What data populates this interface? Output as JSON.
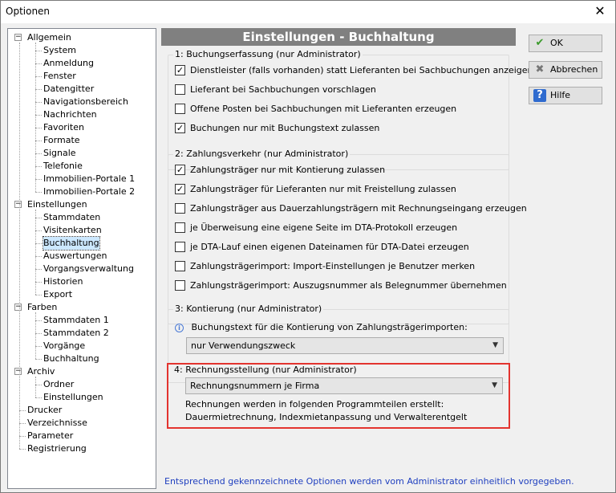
{
  "window": {
    "title": "Optionen",
    "close": "✕"
  },
  "tree": {
    "root": [
      {
        "label": "Allgemein",
        "children": [
          "System",
          "Anmeldung",
          "Fenster",
          "Datengitter",
          "Navigationsbereich",
          "Nachrichten",
          "Favoriten",
          "Formate",
          "Signale",
          "Telefonie",
          "Immobilien-Portale 1",
          "Immobilien-Portale 2"
        ]
      },
      {
        "label": "Einstellungen",
        "children": [
          "Stammdaten",
          "Visitenkarten",
          "Buchhaltung",
          "Auswertungen",
          "Vorgangsverwaltung",
          "Historien",
          "Export"
        ]
      },
      {
        "label": "Farben",
        "children": [
          "Stammdaten 1",
          "Stammdaten 2",
          "Vorgänge",
          "Buchhaltung"
        ]
      },
      {
        "label": "Archiv",
        "children": [
          "Ordner",
          "Einstellungen"
        ]
      }
    ],
    "leaves": [
      "Drucker",
      "Verzeichnisse",
      "Parameter",
      "Registrierung"
    ],
    "selected": "Buchhaltung"
  },
  "panel": {
    "title": "Einstellungen - Buchhaltung",
    "groups": {
      "g1": {
        "label": "1: Buchungserfassung  (nur Administrator)",
        "options": [
          {
            "label": "Dienstleister (falls vorhanden) statt Lieferanten bei Sachbuchungen anzeigen",
            "checked": "✓"
          },
          {
            "label": "Lieferant bei Sachbuchungen vorschlagen",
            "checked": ""
          },
          {
            "label": "Offene Posten bei Sachbuchungen mit Lieferanten erzeugen",
            "checked": ""
          },
          {
            "label": "Buchungen nur mit Buchungstext zulassen",
            "checked": "✓"
          }
        ]
      },
      "g2": {
        "label": "2: Zahlungsverkehr  (nur Administrator)",
        "options": [
          {
            "label": "Zahlungsträger nur mit Kontierung zulassen",
            "checked": "✓"
          },
          {
            "label": "Zahlungsträger für Lieferanten nur mit Freistellung zulassen",
            "checked": "✓"
          },
          {
            "label": "Zahlungsträger aus Dauerzahlungsträgern mit Rechnungseingang erzeugen",
            "checked": ""
          },
          {
            "label": "je Überweisung eine eigene Seite im DTA-Protokoll erzeugen",
            "checked": ""
          },
          {
            "label": "je DTA-Lauf einen eigenen Dateinamen für DTA-Datei erzeugen",
            "checked": ""
          },
          {
            "label": "Zahlungsträgerimport: Import-Einstellungen je Benutzer merken",
            "checked": ""
          },
          {
            "label": "Zahlungsträgerimport: Auszugsnummer als Belegnummer übernehmen",
            "checked": ""
          }
        ]
      },
      "g3": {
        "label": "3: Kontierung  (nur Administrator)",
        "info_icon": "i",
        "description": "Buchungstext für die Kontierung von Zahlungsträgerimporten:",
        "select_value": "nur Verwendungszweck"
      },
      "g4": {
        "label": "4: Rechnungsstellung  (nur Administrator)",
        "select_value": "Rechnungsnummern je Firma",
        "text_line1": "Rechnungen werden in folgenden Programmteilen erstellt:",
        "text_line2": "Dauermietrechnung, Indexmietanpassung und Verwalterentgelt"
      }
    }
  },
  "buttons": {
    "ok": {
      "label": "OK",
      "icon": "✔"
    },
    "cancel": {
      "label": "Abbrechen",
      "icon": "✖"
    },
    "help": {
      "label": "Hilfe",
      "icon": "?"
    }
  },
  "footer": "Entsprechend gekennzeichnete Optionen werden vom Administrator einheitlich vorgegeben.",
  "colors": {
    "accent_red": "#e3342f",
    "header_gray": "#808080",
    "footer_blue": "#1f3fbf",
    "select_bg": "#cce8ff"
  }
}
